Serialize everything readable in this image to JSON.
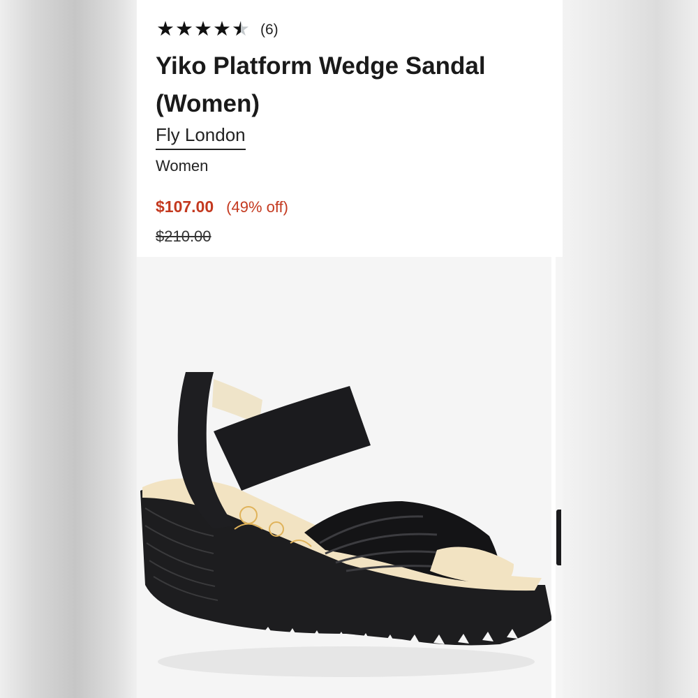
{
  "product": {
    "rating": {
      "value": 4.5,
      "max": 5,
      "count_label": "(6)"
    },
    "title": "Yiko Platform Wedge Sandal (Women)",
    "brand": "Fly London",
    "category": "Women",
    "price": {
      "sale": "$107.00",
      "discount": "(49% off)",
      "original": "$210.00"
    },
    "image": {
      "alt": "sandal-photo"
    }
  },
  "colors": {
    "sale_price": "#c4391f",
    "star_filled": "#111111",
    "star_empty": "#c4c9cc"
  }
}
